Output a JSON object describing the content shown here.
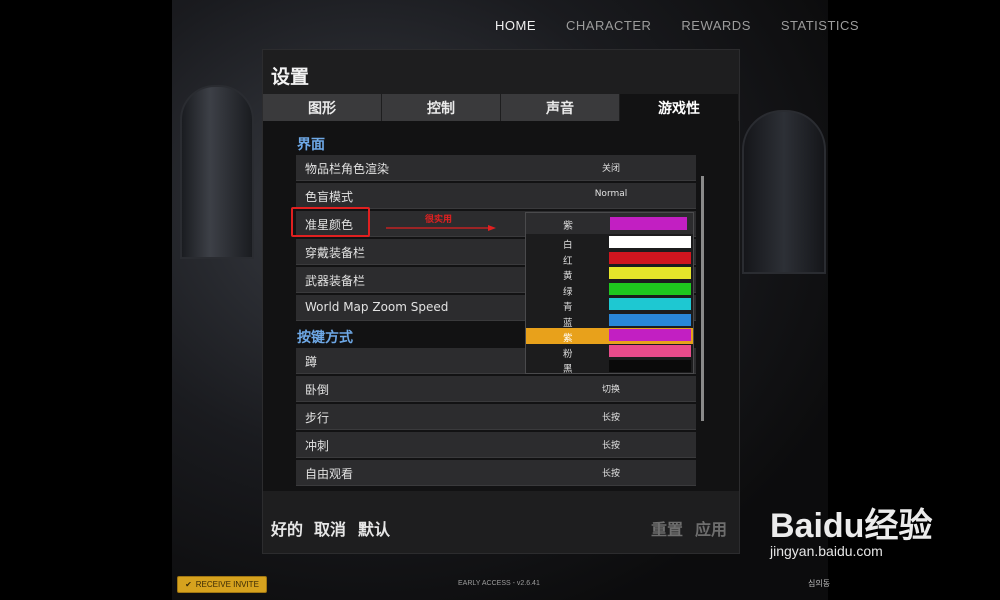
{
  "top_nav": [
    "HOME",
    "CHARACTER",
    "REWARDS",
    "STATISTICS"
  ],
  "settings": {
    "title": "设置",
    "tabs": [
      "图形",
      "控制",
      "声音",
      "游戏性"
    ],
    "active_tab": "游戏性",
    "sections": {
      "interface": "界面",
      "keys": "按键方式"
    },
    "interface_rows": [
      {
        "label": "物品栏角色渲染",
        "value": "关闭"
      },
      {
        "label": "色盲模式",
        "value": "Normal"
      },
      {
        "label": "准星颜色",
        "value": ""
      },
      {
        "label": "穿戴装备栏",
        "value": ""
      },
      {
        "label": "武器装备栏",
        "value": ""
      },
      {
        "label": "World Map Zoom Speed",
        "value": ""
      }
    ],
    "key_rows": [
      {
        "label": "蹲",
        "value": ""
      },
      {
        "label": "卧倒",
        "value": "切换"
      },
      {
        "label": "步行",
        "value": "长按"
      },
      {
        "label": "冲刺",
        "value": "长按"
      },
      {
        "label": "自由观看",
        "value": "长按"
      }
    ],
    "annotation": "很实用",
    "crosshair_dropdown": {
      "current": {
        "label": "紫",
        "color": "#c21fc2"
      },
      "options": [
        {
          "label": "白",
          "color": "#ffffff"
        },
        {
          "label": "红",
          "color": "#d0151f"
        },
        {
          "label": "黄",
          "color": "#e6e62a"
        },
        {
          "label": "绿",
          "color": "#1ec81e"
        },
        {
          "label": "青",
          "color": "#1ec8d2"
        },
        {
          "label": "蓝",
          "color": "#2a86d8"
        },
        {
          "label": "紫",
          "color": "#c21fc2",
          "selected": true
        },
        {
          "label": "粉",
          "color": "#e84b8a"
        },
        {
          "label": "黑",
          "color": "#0a0a0a"
        }
      ]
    },
    "footer": {
      "ok": "好的",
      "cancel": "取消",
      "default": "默认",
      "reset": "重置",
      "apply": "应用"
    }
  },
  "bottom": {
    "receive_invite": "RECEIVE INVITE",
    "version": "EARLY ACCESS - v2.6.41",
    "user": "심의동"
  },
  "watermark": {
    "brand": "Baidu经验",
    "url": "jingyan.baidu.com"
  }
}
